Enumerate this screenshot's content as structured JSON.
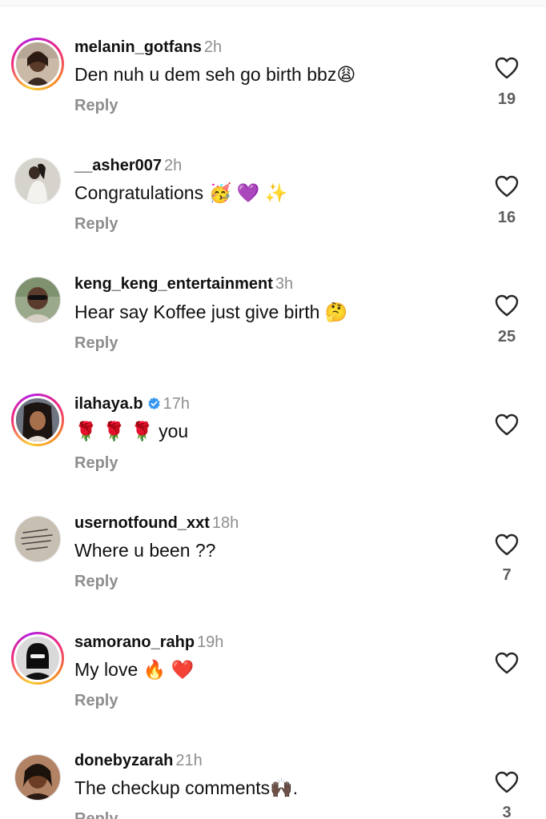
{
  "reply_label": "Reply",
  "comments": [
    {
      "username": "melanin_gotfans",
      "time": "2h",
      "text": "Den nuh u dem seh go birth bbz😩",
      "likes": "19",
      "story_ring": true,
      "verified": false
    },
    {
      "username": "__asher007",
      "time": "2h",
      "text": "Congratulations 🥳 💜 ✨",
      "likes": "16",
      "story_ring": false,
      "verified": false
    },
    {
      "username": "keng_keng_entertainment",
      "time": "3h",
      "text": "Hear say Koffee just give birth 🤔",
      "likes": "25",
      "story_ring": false,
      "verified": false
    },
    {
      "username": "ilahaya.b",
      "time": "17h",
      "text": "🌹 🌹 🌹 you",
      "likes": "",
      "story_ring": true,
      "verified": true
    },
    {
      "username": "usernotfound_xxt",
      "time": "18h",
      "text": "Where u been ??",
      "likes": "7",
      "story_ring": false,
      "verified": false
    },
    {
      "username": "samorano_rahp",
      "time": "19h",
      "text": "My love 🔥 ❤️",
      "likes": "",
      "story_ring": true,
      "verified": false
    },
    {
      "username": "donebyzarah",
      "time": "21h",
      "text": "The checkup comments🙌🏿.",
      "likes": "3",
      "story_ring": false,
      "verified": false
    }
  ],
  "colors": {
    "secondary_text": "#8e8e8e",
    "verified_blue": "#3797f0",
    "story_gradient": [
      "#f9ce34",
      "#ee2a7b",
      "#b620e0"
    ]
  },
  "icons": {
    "like": "heart-outline-icon",
    "verified": "verified-badge-icon"
  }
}
